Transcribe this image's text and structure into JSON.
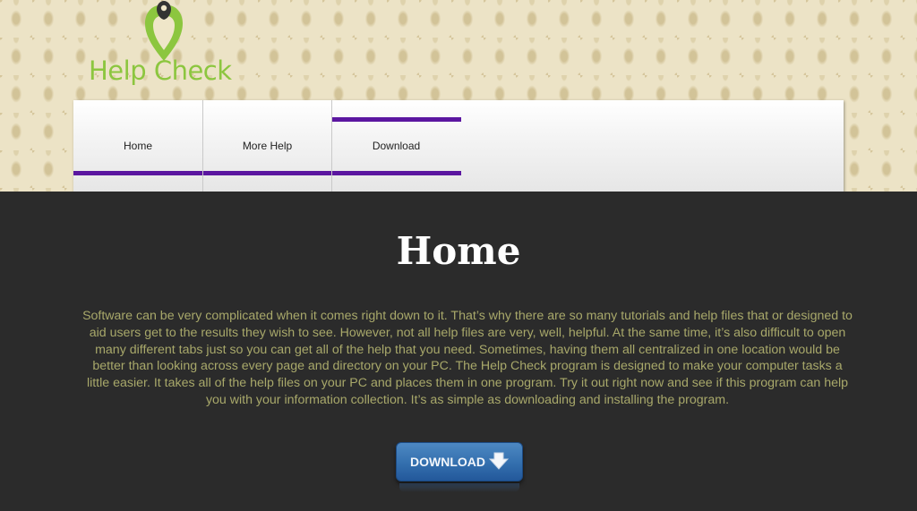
{
  "logo": {
    "text": "Help Check",
    "icon": "map-pin-heart-icon",
    "color": "#8cc63f"
  },
  "nav": {
    "items": [
      {
        "label": "Home",
        "active": true
      },
      {
        "label": "More Help",
        "active": false
      },
      {
        "label": "Download",
        "active": false
      }
    ],
    "accent_color": "#5b16a0"
  },
  "main": {
    "title": "Home",
    "body": "Software can be very complicated when it comes right down to it. That’s why there are so many tutorials and help files that or designed to aid users get to the results they wish to see. However, not all help files are very, well, helpful. At the same time, it’s also difficult to open many different tabs just so you can get all of the help that you need. Sometimes, having them all centralized in one location would be better than looking across every page and directory on your PC. The Help Check program is designed to make your computer tasks a little easier. It takes all of the help files on your PC and places them in one program. Try it out right now and see if this program can help you with your information collection. It’s as simple as downloading and installing the program.",
    "text_color": "#a8a86a",
    "background": "#2b2b2b"
  },
  "download_button": {
    "label": "DOWNLOAD",
    "icon": "down-arrow-icon",
    "color": "#336fae"
  }
}
